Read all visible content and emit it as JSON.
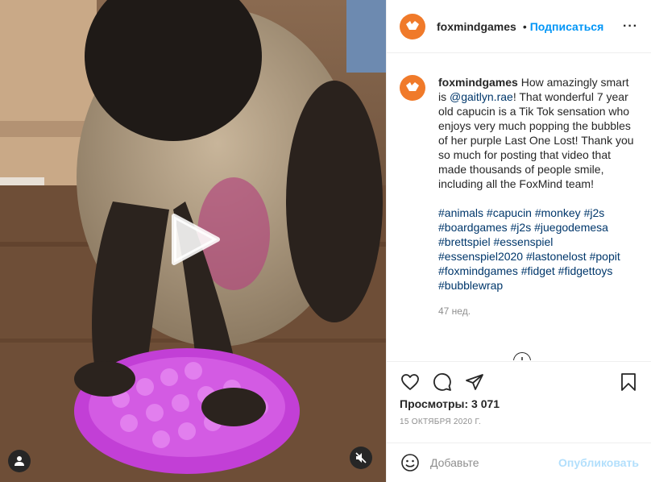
{
  "account": {
    "username": "foxmindgames",
    "follow_label": "Подписаться",
    "dot": "•",
    "more": "···",
    "avatar_text": "FoxMind"
  },
  "caption": {
    "username": "foxmindgames",
    "text_before_mention": "How amazingly smart is ",
    "mention": "@gaitlyn.rae",
    "text_after_mention": "! That wonderful 7 year old capucin is a Tik Tok sensation who enjoys very much popping the bubbles of her purple Last One Lost! Thank you so much for posting that video that made thousands of people smile, including all the FoxMind team!",
    "hashtags": [
      "#animals",
      "#capucin",
      "#monkey",
      "#j2s",
      "#boardgames",
      "#j2s",
      "#juegodemesa",
      "#brettspiel",
      "#essenspiel",
      "#essenspiel2020",
      "#lastonelost",
      "#popit",
      "#foxmindgames",
      "#fidget",
      "#fidgettoys",
      "#bubblewrap"
    ],
    "time_ago": "47 нед."
  },
  "stats": {
    "views_label": "Просмотры: 3 071",
    "date": "15 ОКТЯБРЯ 2020 Г."
  },
  "comment_box": {
    "placeholder": "Добавьте",
    "publish_label": "Опубликовать"
  },
  "icons": {
    "like": "heart-icon",
    "comment": "comment-icon",
    "share": "share-icon",
    "save": "bookmark-icon",
    "play": "play-icon",
    "user_tag": "user-icon",
    "mute": "muted-speaker-icon",
    "emoji": "emoji-icon",
    "load_more": "plus-circle-icon"
  },
  "colors": {
    "link_blue": "#0095f6",
    "hashtag": "#00376b",
    "muted_text": "#8e8e8e",
    "brand_orange": "#f07a2a",
    "publish_disabled": "#b2dffc",
    "toy_purple": "#c23fd6"
  }
}
